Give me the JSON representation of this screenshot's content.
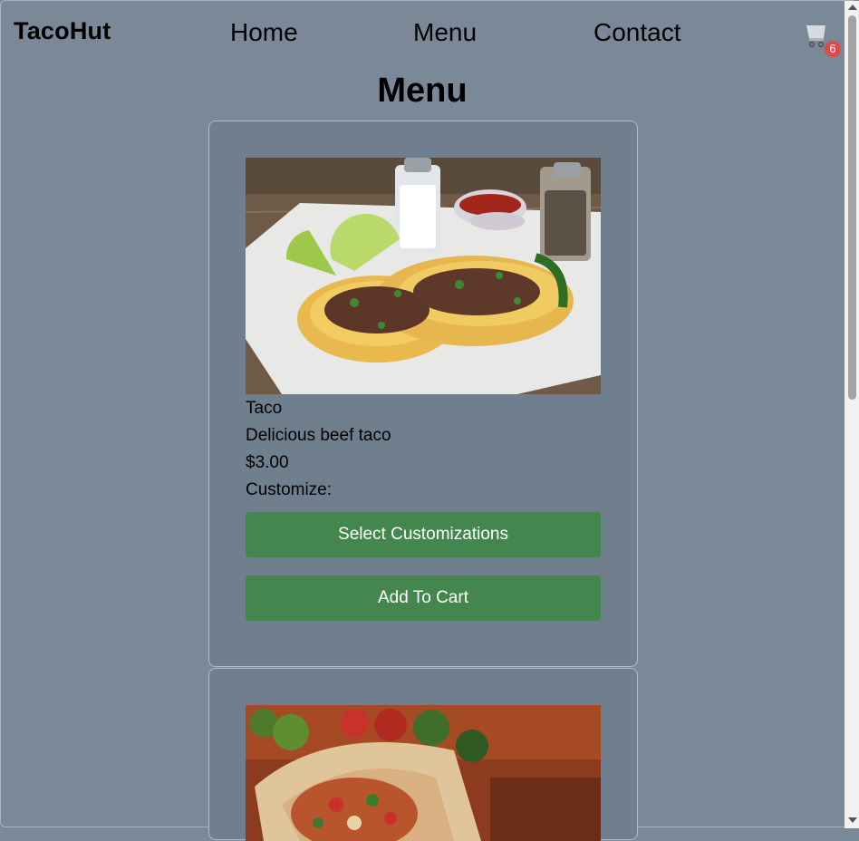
{
  "nav": {
    "brand": "TacoHut",
    "links": [
      "Home",
      "Menu",
      "Contact"
    ],
    "cart_icon": "shopping-cart-icon",
    "cart_count": "6"
  },
  "page": {
    "title": "Menu"
  },
  "menu_items": [
    {
      "name": "Taco",
      "description": "Delicious beef taco",
      "price": "$3.00",
      "customize_label": "Customize:",
      "customize_button": "Select Customizations",
      "add_button": "Add To Cart"
    }
  ],
  "colors": {
    "background": "#7b8897",
    "card": "#6f7f8e",
    "button": "#44874e",
    "badge": "#e34848"
  }
}
